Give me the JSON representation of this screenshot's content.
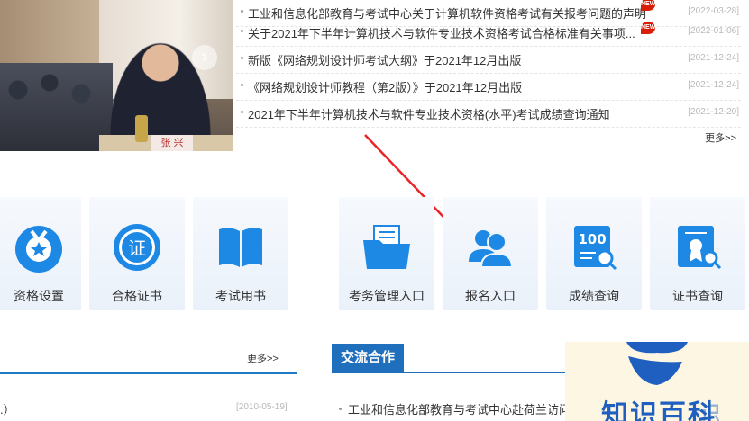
{
  "news": {
    "items": [
      {
        "title": "工业和信息化部教育与考试中心关于计算机软件资格考试有关报考问题的声明",
        "date": "[2022-03-28]",
        "badge": "NEW"
      },
      {
        "title": "关于2021年下半年计算机技术与软件专业技术资格考试合格标准有关事项...",
        "date": "[2022-01-06]",
        "badge": "NEW"
      },
      {
        "title": "新版《网络规划设计师考试大纲》于2021年12月出版",
        "date": "[2021-12-24]",
        "badge": ""
      },
      {
        "title": "《网络规划设计师教程（第2版）》于2021年12月出版",
        "date": "[2021-12-24]",
        "badge": ""
      },
      {
        "title": "2021年下半年计算机技术与软件专业技术资格(水平)考试成绩查询通知",
        "date": "[2021-12-20]",
        "badge": ""
      }
    ],
    "more": "更多>>"
  },
  "photo": {
    "nameplate": "张 兴"
  },
  "tiles": [
    {
      "label": "资格设置",
      "icon": "medal-icon"
    },
    {
      "label": "合格证书",
      "icon": "certificate-seal-icon"
    },
    {
      "label": "考试用书",
      "icon": "book-icon"
    },
    {
      "label": "考务管理入口",
      "icon": "folder-icon"
    },
    {
      "label": "报名入口",
      "icon": "users-icon"
    },
    {
      "label": "成绩查询",
      "icon": "score-search-icon"
    },
    {
      "label": "证书查询",
      "icon": "certificate-search-icon"
    }
  ],
  "left_section": {
    "more": "更多>>",
    "item": ".）",
    "date": "[2010-05-19]"
  },
  "right_section": {
    "tab": "交流合作",
    "item": "工业和信息化部教育与考试中心赴荷兰访问"
  },
  "watermark": {
    "text": "知识百科",
    "extra": "识"
  },
  "colors": {
    "accent": "#1f6fbd",
    "tile_icon": "#1e88e5",
    "arrow": "#e8262a"
  }
}
